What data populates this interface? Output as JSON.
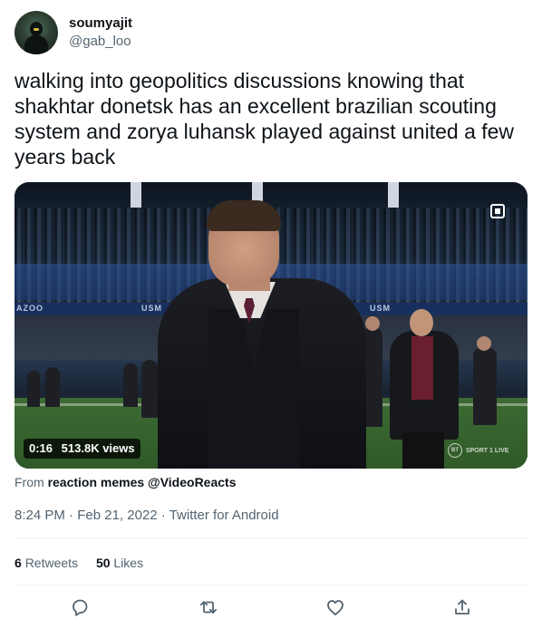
{
  "author": {
    "display_name": "soumyajit",
    "handle": "@gab_loo"
  },
  "tweet": {
    "text": "walking into geopolitics discussions knowing that shakhtar donetsk has an excellent brazilian scouting system and zorya luhansk played against united a few years back"
  },
  "media": {
    "duration": "0:16",
    "views": "513.8K views",
    "watermark_badge": "BT",
    "watermark_text": "SPORT 1 LIVE",
    "board_text_left": "AZOO",
    "board_text_mid": "USM",
    "board_text_right": "USM"
  },
  "attribution": {
    "prefix": "From",
    "source": "reaction memes @VideoReacts"
  },
  "meta": {
    "time": "8:24 PM",
    "separator": " · ",
    "date": "Feb 21, 2022",
    "client": "Twitter for Android"
  },
  "engagement": {
    "retweets_count": "6",
    "retweets_label": "Retweets",
    "likes_count": "50",
    "likes_label": "Likes"
  },
  "actions": {
    "reply_icon": "reply-icon",
    "retweet_icon": "retweet-icon",
    "like_icon": "heart-icon",
    "share_icon": "share-icon"
  },
  "colors": {
    "text_primary": "#0f1419",
    "text_secondary": "#536471",
    "divider": "#eff3f4"
  }
}
